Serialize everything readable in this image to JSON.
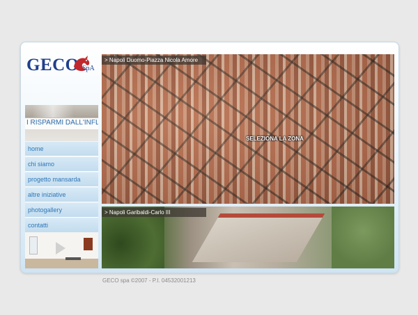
{
  "logo": {
    "text": "GECO",
    "suffix": "SpA"
  },
  "banner": {
    "text": "I RISPARMI DALL'INFL"
  },
  "menu": {
    "items": [
      {
        "label": "home"
      },
      {
        "label": "chi siamo"
      },
      {
        "label": "progetto mansarda"
      },
      {
        "label": "altre iniziative"
      },
      {
        "label": "photogallery"
      },
      {
        "label": "contatti"
      }
    ]
  },
  "photos": {
    "top_label": "> Napoli Duomo-Piazza Nicola Amore",
    "bottom_label": "> Napoli Garibaldi-Carlo III",
    "select_zone": "SELEZIONA LA ZONA"
  },
  "footer": {
    "text": "GECO spa ©2007 - P.I. 04532001213"
  },
  "colors": {
    "menu_text": "#2d77b8",
    "logo": "#1e3f8a",
    "logo_accent": "#c0282d",
    "background": "#e9e9e9"
  }
}
